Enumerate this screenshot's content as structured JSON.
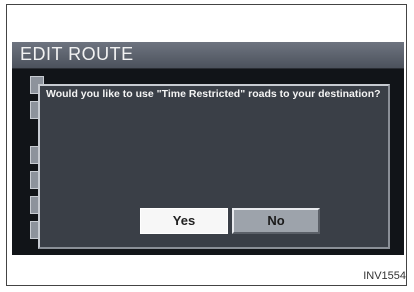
{
  "screen": {
    "title": "EDIT ROUTE"
  },
  "dialog": {
    "message": "Would you like to use \"Time Restricted\" roads to your destination?",
    "buttons": {
      "yes_label": "Yes",
      "no_label": "No"
    },
    "selected_button": "No"
  },
  "figure_ref": "INV1554"
}
